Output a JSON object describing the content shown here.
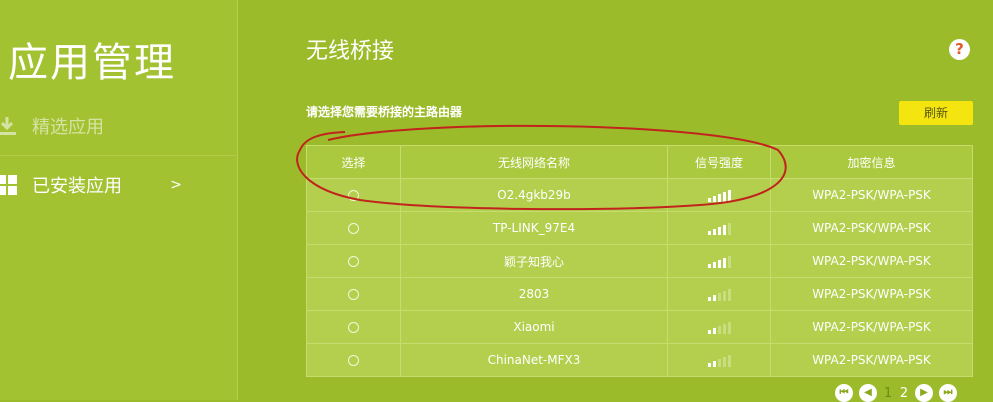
{
  "sidebar": {
    "title": "应用管理",
    "items": [
      {
        "label": "精选应用",
        "icon": "download-icon"
      },
      {
        "label": "已安装应用",
        "icon": "grid-icon",
        "chevron": ">"
      }
    ]
  },
  "main": {
    "title": "无线桥接",
    "help_label": "?",
    "instruction": "请选择您需要桥接的主路由器",
    "refresh_label": "刷新",
    "table": {
      "headers": [
        "选择",
        "无线网络名称",
        "信号强度",
        "加密信息"
      ],
      "rows": [
        {
          "ssid": "O2.4gkb29b",
          "signal": 5,
          "security": "WPA2-PSK/WPA-PSK"
        },
        {
          "ssid": "TP-LINK_97E4",
          "signal": 4,
          "security": "WPA2-PSK/WPA-PSK"
        },
        {
          "ssid": "颖子知我心",
          "signal": 4,
          "security": "WPA2-PSK/WPA-PSK"
        },
        {
          "ssid": "2803",
          "signal": 2,
          "security": "WPA2-PSK/WPA-PSK"
        },
        {
          "ssid": "Xiaomi",
          "signal": 2,
          "security": "WPA2-PSK/WPA-PSK"
        },
        {
          "ssid": "ChinaNet-MFX3",
          "signal": 2,
          "security": "WPA2-PSK/WPA-PSK"
        }
      ]
    },
    "pagination": {
      "first": "⏮",
      "prev": "◀",
      "pages": [
        "1",
        "2"
      ],
      "current": "2",
      "next": "▶",
      "last": "⏭"
    }
  },
  "colors": {
    "background": "#9cbb2b",
    "refresh_button": "#f4e40f",
    "annotation_stroke": "#c0241c"
  }
}
